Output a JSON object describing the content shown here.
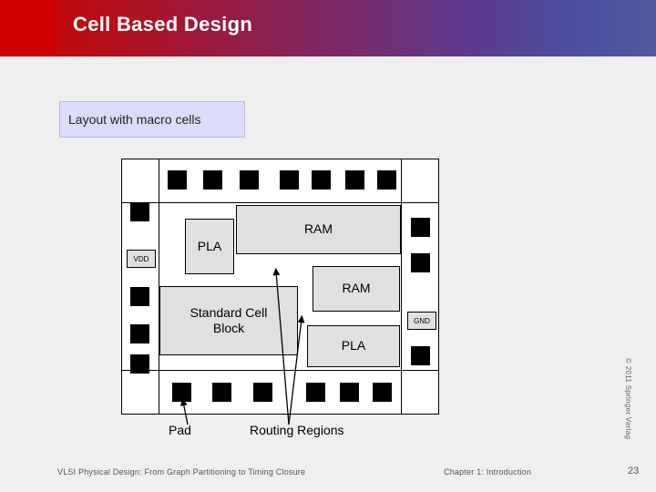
{
  "slide": {
    "title": "Cell Based Design",
    "caption": "Layout with macro cells"
  },
  "diagram": {
    "blocks": [
      {
        "name": "pla-top",
        "label": "PLA"
      },
      {
        "name": "ram-top",
        "label": "RAM"
      },
      {
        "name": "ram-mid",
        "label": "RAM"
      },
      {
        "name": "standard-cell-block",
        "label": "Standard Cell\nBlock"
      },
      {
        "name": "pla-bottom",
        "label": "PLA"
      }
    ],
    "power_pads": [
      {
        "name": "vdd-pad",
        "label": "VDD"
      },
      {
        "name": "gnd-pad",
        "label": "GND"
      }
    ],
    "annotations": [
      {
        "name": "pad-label",
        "label": "Pad"
      },
      {
        "name": "routing-regions-label",
        "label": "Routing Regions"
      }
    ]
  },
  "footer": {
    "left": "VLSI Physical Design: From Graph Partitioning to Timing Closure",
    "center": "Chapter 1: Introduction",
    "page": "23",
    "side_credit": "© 2011 Springer Verlag"
  }
}
